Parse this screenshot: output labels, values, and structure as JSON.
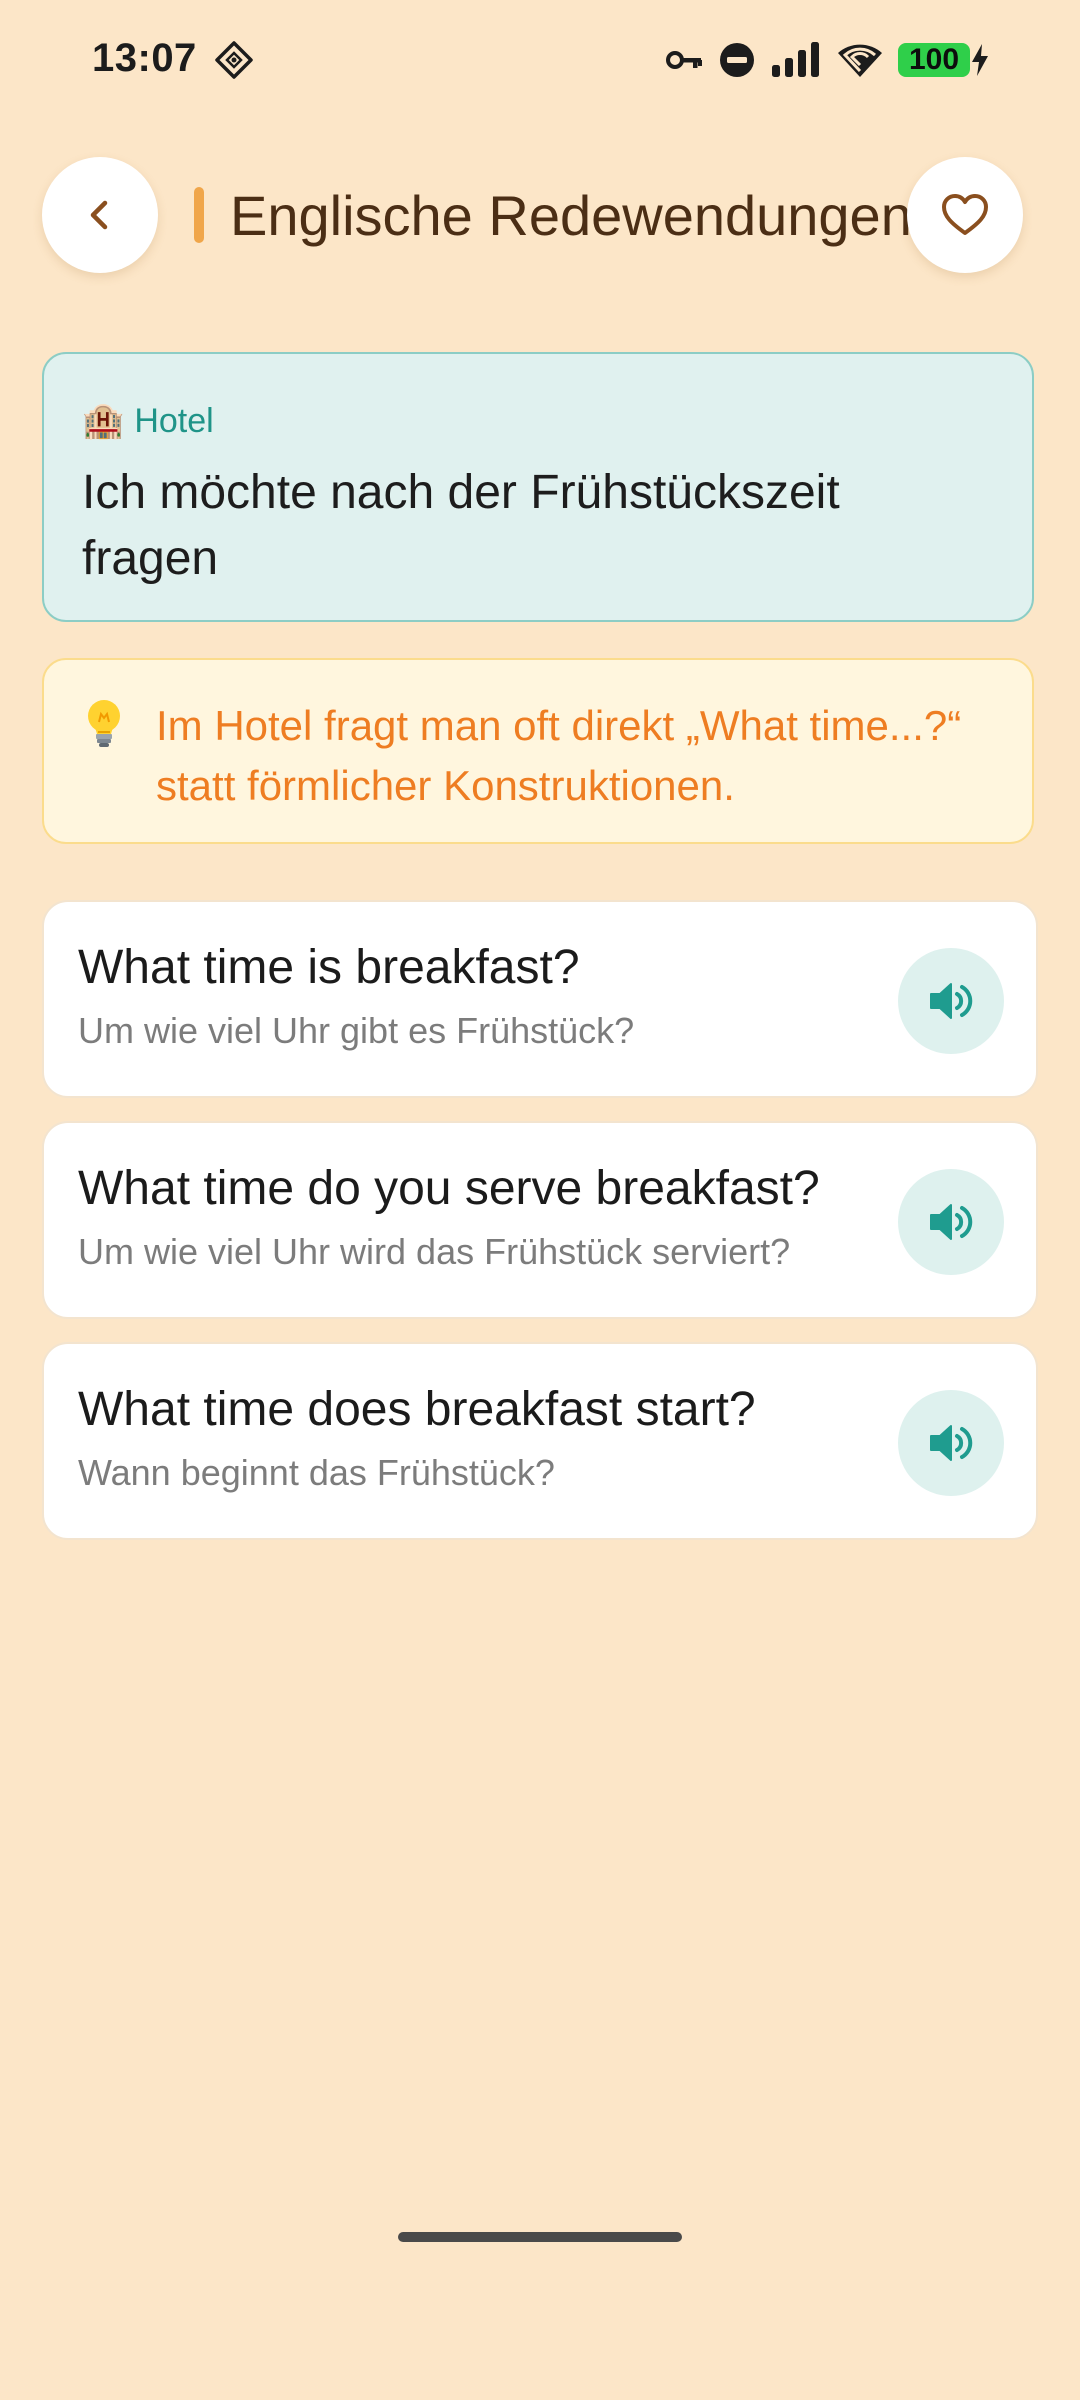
{
  "status_bar": {
    "time": "13:07",
    "battery": "100"
  },
  "header": {
    "title": "Englische Redewendungen"
  },
  "scenario": {
    "emoji": "🏨",
    "category": "Hotel",
    "title": "Ich möchte nach der Frühstückszeit fragen"
  },
  "tip": {
    "text": "Im Hotel fragt man oft direkt „What time...?“ statt förmlicher Konstruktionen."
  },
  "phrases": [
    {
      "english": "What time is breakfast?",
      "german": "Um wie viel Uhr gibt es Frühstück?"
    },
    {
      "english": "What time do you serve breakfast?",
      "german": "Um wie viel Uhr wird das Frühstück serviert?"
    },
    {
      "english": "What time does breakfast start?",
      "german": "Wann beginnt das Frühstück?"
    }
  ],
  "colors": {
    "background": "#fce6c8",
    "accent": "#f0a64a",
    "teal": "#1f9488",
    "tip_text": "#ee7d22",
    "title": "#4b2e15"
  },
  "icons": {
    "back": "chevron-left-icon",
    "favorite": "heart-outline-icon",
    "tip": "lightbulb-icon",
    "speak": "speaker-icon"
  }
}
